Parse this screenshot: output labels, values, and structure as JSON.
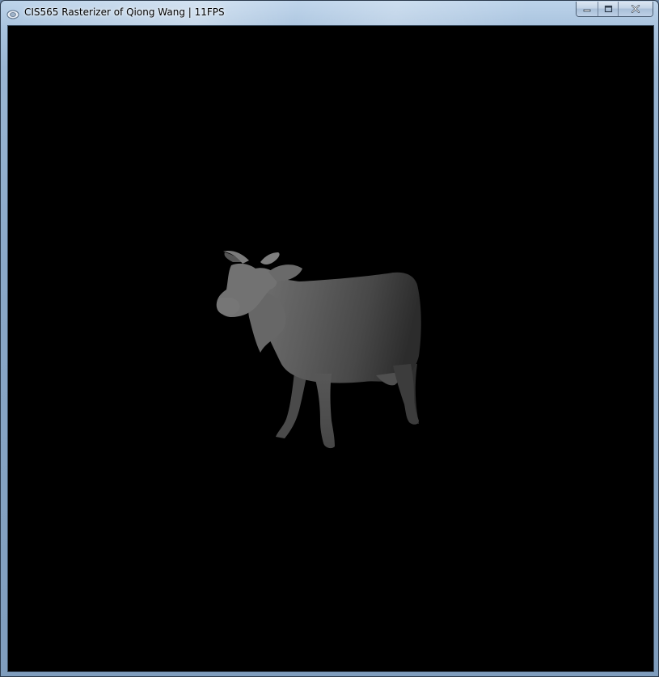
{
  "window": {
    "title": "CIS565 Rasterizer of Qiong Wang | 11FPS",
    "icons": {
      "app": "app-window-icon",
      "minimize": "minimize-icon",
      "maximize": "maximize-icon",
      "close": "close-icon"
    }
  },
  "viewport": {
    "background_color": "#000000",
    "model": "cow",
    "shading": "grayscale depth"
  }
}
